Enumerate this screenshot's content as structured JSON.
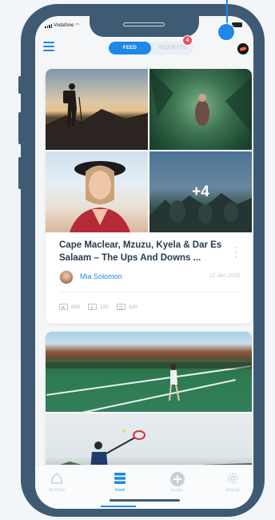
{
  "status_bar": {
    "carrier": "Vodafone"
  },
  "header": {
    "tabs": [
      {
        "label": "FEED",
        "active": true
      },
      {
        "label": "REQUESTS",
        "active": false
      }
    ],
    "requests_badge": "4"
  },
  "feed": {
    "posts": [
      {
        "more_photos_label": "+4",
        "title": "Cape Maclear, Mzuzu, Kyela & Dar Es Salaam – The Ups And Downs ...",
        "author": "Mia Solomon",
        "date": "12 Jan 2018",
        "stats": {
          "photos": "609",
          "videos": "120",
          "audio": "320"
        }
      }
    ]
  },
  "bottom_nav": {
    "items": [
      {
        "label": "My Posts",
        "icon": "home-icon"
      },
      {
        "label": "Feed",
        "icon": "feed-icon",
        "active": true
      },
      {
        "label": "Create",
        "icon": "plus-icon"
      },
      {
        "label": "Settings",
        "icon": "gear-icon"
      }
    ]
  },
  "colors": {
    "accent": "#1e88e5",
    "badge": "#ef4f5f",
    "phone_frame": "#3f5a73"
  }
}
